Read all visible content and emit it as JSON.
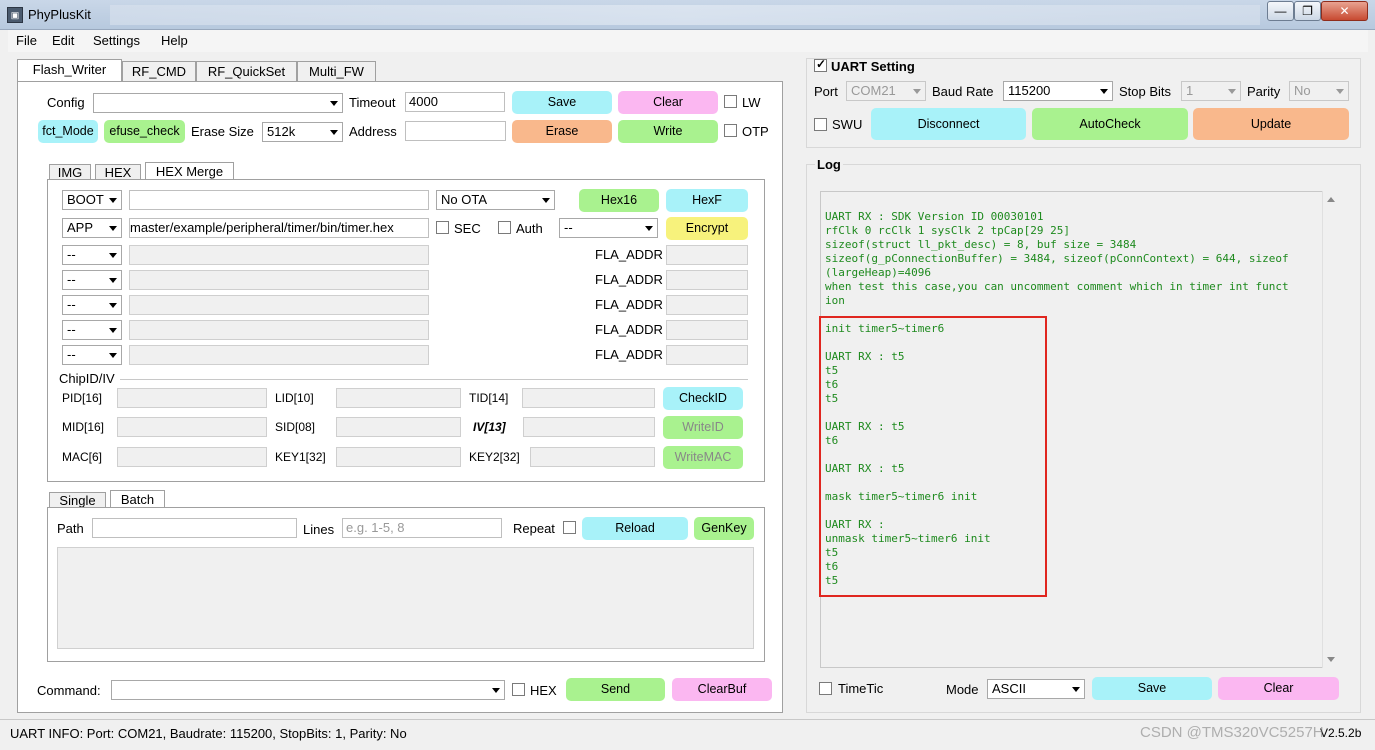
{
  "window": {
    "title": "PhyPlusKit",
    "min": "—",
    "max": "❐",
    "close": "✕"
  },
  "menu": [
    "File",
    "Edit",
    "Settings",
    "Help"
  ],
  "main_tabs": [
    "Flash_Writer",
    "RF_CMD",
    "RF_QuickSet",
    "Multi_FW"
  ],
  "flash": {
    "config_label": "Config",
    "config_value": "",
    "timeout_label": "Timeout",
    "timeout_value": "4000",
    "save": "Save",
    "clear": "Clear",
    "lw": "LW",
    "fct_mode": "fct_Mode",
    "efuse_check": "efuse_check",
    "erase_size_label": "Erase Size",
    "erase_size_value": "512k",
    "address_label": "Address",
    "address_value": "",
    "erase": "Erase",
    "write": "Write",
    "otp": "OTP"
  },
  "sub_tabs": [
    "IMG",
    "HEX",
    "HEX Merge"
  ],
  "hexmerge": {
    "boot": "BOOT",
    "boot_path": "",
    "ota": "No OTA",
    "hex16": "Hex16",
    "hexf": "HexF",
    "app": "APP",
    "app_path": "master/example/peripheral/timer/bin/timer.hex",
    "sec": "SEC",
    "auth": "Auth",
    "auth_sel": "--",
    "encrypt": "Encrypt",
    "rows": [
      {
        "sel": "--",
        "fla": "FLA_ADDR"
      },
      {
        "sel": "--",
        "fla": "FLA_ADDR"
      },
      {
        "sel": "--",
        "fla": "FLA_ADDR"
      },
      {
        "sel": "--",
        "fla": "FLA_ADDR"
      },
      {
        "sel": "--",
        "fla": "FLA_ADDR"
      }
    ]
  },
  "chipid": {
    "group": "ChipID/IV",
    "pid": "PID[16]",
    "lid": "LID[10]",
    "tid": "TID[14]",
    "checkid": "CheckID",
    "mid": "MID[16]",
    "sid": "SID[08]",
    "iv": "IV[13]",
    "writeid": "WriteID",
    "mac": "MAC[6]",
    "key1": "KEY1[32]",
    "key2": "KEY2[32]",
    "writemac": "WriteMAC"
  },
  "batch_tabs": [
    "Single",
    "Batch"
  ],
  "batch": {
    "path_label": "Path",
    "lines_label": "Lines",
    "lines_placeholder": "e.g. 1-5, 8",
    "repeat": "Repeat",
    "reload": "Reload",
    "genkey": "GenKey"
  },
  "command": {
    "label": "Command:",
    "hex": "HEX",
    "send": "Send",
    "clearbuf": "ClearBuf"
  },
  "uart": {
    "group": "UART Setting",
    "port_label": "Port",
    "port_value": "COM21",
    "baud_label": "Baud Rate",
    "baud_value": "115200",
    "stop_label": "Stop Bits",
    "stop_value": "1",
    "parity_label": "Parity",
    "parity_value": "No",
    "swu": "SWU",
    "disconnect": "Disconnect",
    "autocheck": "AutoCheck",
    "update": "Update"
  },
  "log": {
    "group": "Log",
    "lines": [
      "UART RX : SDK Version ID 00030101",
      "rfClk 0 rcClk 1 sysClk 2 tpCap[29 25]",
      "sizeof(struct ll_pkt_desc) = 8, buf size = 3484",
      "sizeof(g_pConnectionBuffer) = 3484, sizeof(pConnContext) = 644, sizeof",
      "(largeHeap)=4096",
      "when test this case,you can uncomment comment which in timer int funct",
      "ion",
      "",
      "init timer5~timer6",
      "",
      "UART RX : t5",
      "t5",
      "t6",
      "t5",
      "",
      "UART RX : t5",
      "t6",
      "",
      "UART RX : t5",
      "",
      "mask timer5~timer6 init",
      "",
      "UART RX :",
      "unmask timer5~timer6 init",
      "t5",
      "t6",
      "t5"
    ],
    "timetic": "TimeTic",
    "mode_label": "Mode",
    "mode_value": "ASCII",
    "save": "Save",
    "clear": "Clear"
  },
  "status": {
    "info": "UART INFO: Port: COM21, Baudrate: 115200, StopBits: 1, Parity: No",
    "version": "V2.5.2b",
    "watermark": "CSDN @TMS320VC5257H"
  }
}
